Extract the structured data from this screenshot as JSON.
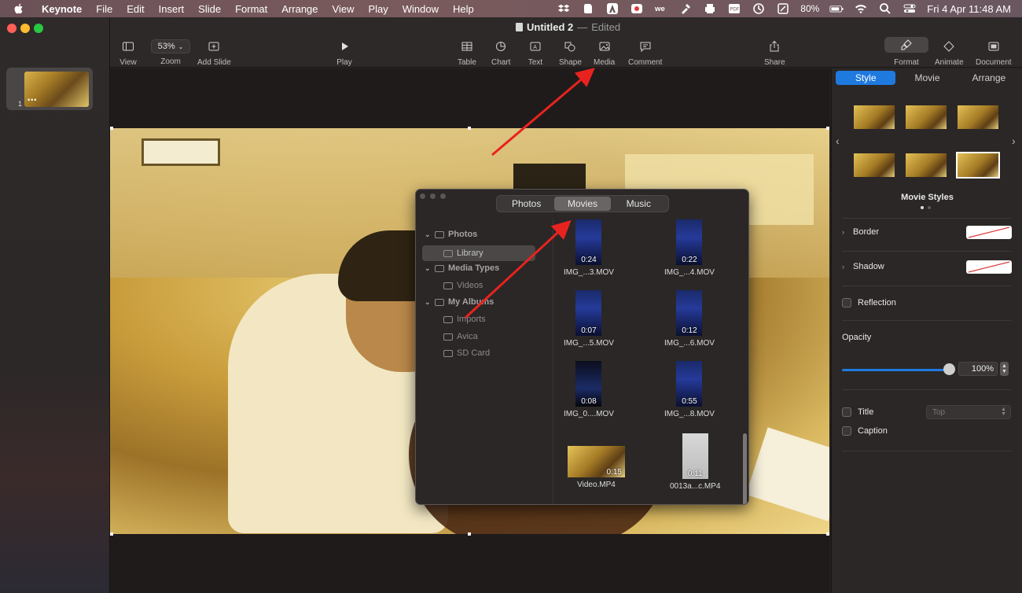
{
  "menubar": {
    "app": "Keynote",
    "items": [
      "File",
      "Edit",
      "Insert",
      "Slide",
      "Format",
      "Arrange",
      "View",
      "Play",
      "Window",
      "Help"
    ],
    "battery": "80%",
    "clock": "Fri 4 Apr  11:48 AM",
    "status_icons": [
      "dropbox-icon",
      "evernote-icon",
      "adobe-icon",
      "creative-cloud-icon",
      "we-icon",
      "tool-icon",
      "printer-icon",
      "pdf-icon",
      "time-machine-icon",
      "note-icon",
      "battery-icon",
      "wifi-icon",
      "search-icon",
      "control-center-icon"
    ]
  },
  "window": {
    "title": "Untitled 2",
    "title_sep": "—",
    "title_state": "Edited"
  },
  "toolbar": {
    "view": "View",
    "zoom_value": "53%",
    "zoom": "Zoom",
    "add_slide": "Add Slide",
    "play": "Play",
    "table": "Table",
    "chart": "Chart",
    "text": "Text",
    "shape": "Shape",
    "media": "Media",
    "comment": "Comment",
    "share": "Share",
    "format": "Format",
    "animate": "Animate",
    "document": "Document"
  },
  "navigator": {
    "slide_number": "1"
  },
  "media_browser": {
    "tabs": [
      {
        "label": "Photos",
        "active": false
      },
      {
        "label": "Movies",
        "active": true
      },
      {
        "label": "Music",
        "active": false
      }
    ],
    "sidebar": {
      "photos": "Photos",
      "library": "Library",
      "media_types": "Media Types",
      "videos": "Videos",
      "my_albums": "My Albums",
      "imports": "Imports",
      "avica": "Avica",
      "sd_card": "SD Card"
    },
    "items": [
      {
        "name": "IMG_...3.MOV",
        "duration": "0:24"
      },
      {
        "name": "IMG_...4.MOV",
        "duration": "0:22"
      },
      {
        "name": "IMG_...5.MOV",
        "duration": "0:07"
      },
      {
        "name": "IMG_...6.MOV",
        "duration": "0:12"
      },
      {
        "name": "IMG_0....MOV",
        "duration": "0:08"
      },
      {
        "name": "IMG_...8.MOV",
        "duration": "0:55"
      },
      {
        "name": "Video.MP4",
        "duration": "0:15"
      },
      {
        "name": "0013a...c.MP4",
        "duration": "0:11"
      }
    ]
  },
  "inspector": {
    "tabs": [
      "Style",
      "Movie",
      "Arrange"
    ],
    "active_tab": "Style",
    "movie_styles": "Movie Styles",
    "border": "Border",
    "shadow": "Shadow",
    "reflection": "Reflection",
    "opacity": "Opacity",
    "opacity_value": "100%",
    "title": "Title",
    "title_position": "Top",
    "caption": "Caption"
  },
  "colors": {
    "accent": "#1f7ae0",
    "annotation_arrow": "#e8231f"
  }
}
